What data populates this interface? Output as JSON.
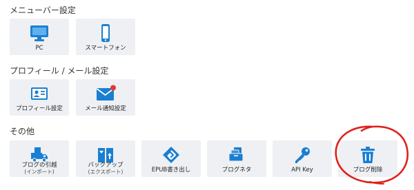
{
  "colors": {
    "accent": "#1a7fd1",
    "tile_background": "#eef0f3",
    "badge": "#e53935",
    "annotation": "#e0201b"
  },
  "sections": [
    {
      "title": "メニューバー設定",
      "tiles": [
        {
          "label": "PC",
          "icon": "monitor-icon"
        },
        {
          "label": "スマートフォン",
          "icon": "smartphone-icon"
        }
      ]
    },
    {
      "title": "プロフィール / メール設定",
      "tiles": [
        {
          "label": "プロフィール設定",
          "icon": "id-card-icon"
        },
        {
          "label": "メール通知設定",
          "icon": "mail-badge-icon"
        }
      ]
    },
    {
      "title": "その他",
      "tiles": [
        {
          "label": "ブログの引越",
          "sub": "(インポート)",
          "icon": "moving-truck-icon"
        },
        {
          "label": "バックアップ",
          "sub": "(エクスポート)",
          "icon": "backup-book-icon"
        },
        {
          "label": "EPUB書き出し",
          "icon": "epub-icon"
        },
        {
          "label": "ブログネタ",
          "icon": "blog-topics-icon"
        },
        {
          "label": "API Key",
          "icon": "key-icon"
        },
        {
          "label": "ブログ削除",
          "icon": "trash-icon"
        }
      ]
    }
  ]
}
